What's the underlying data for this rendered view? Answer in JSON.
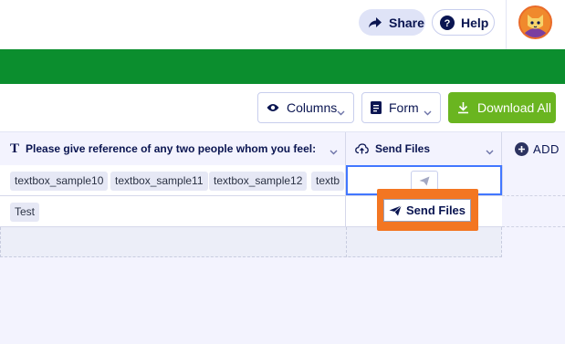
{
  "header": {
    "share_label": "Share",
    "help_label": "Help",
    "avatar_icon": "cat-avatar-icon"
  },
  "banner": {
    "color": "#0b8e2e"
  },
  "toolbar": {
    "columns_label": "Columns",
    "form_label": "Form",
    "download_label": "Download All",
    "download_color": "#6ab520"
  },
  "grid": {
    "columns": [
      {
        "type_icon": "T",
        "label": "Please give reference of any two people whom you feel:"
      },
      {
        "label": "Send Files"
      }
    ],
    "add_label": "ADD",
    "rows": [
      {
        "tags": [
          "textbox_sample10",
          "textbox_sample11",
          "textbox_sample12",
          "textb"
        ]
      },
      {
        "tags": [
          "Test"
        ]
      }
    ]
  },
  "callout": {
    "label": "Send Files",
    "color": "#f37622"
  }
}
